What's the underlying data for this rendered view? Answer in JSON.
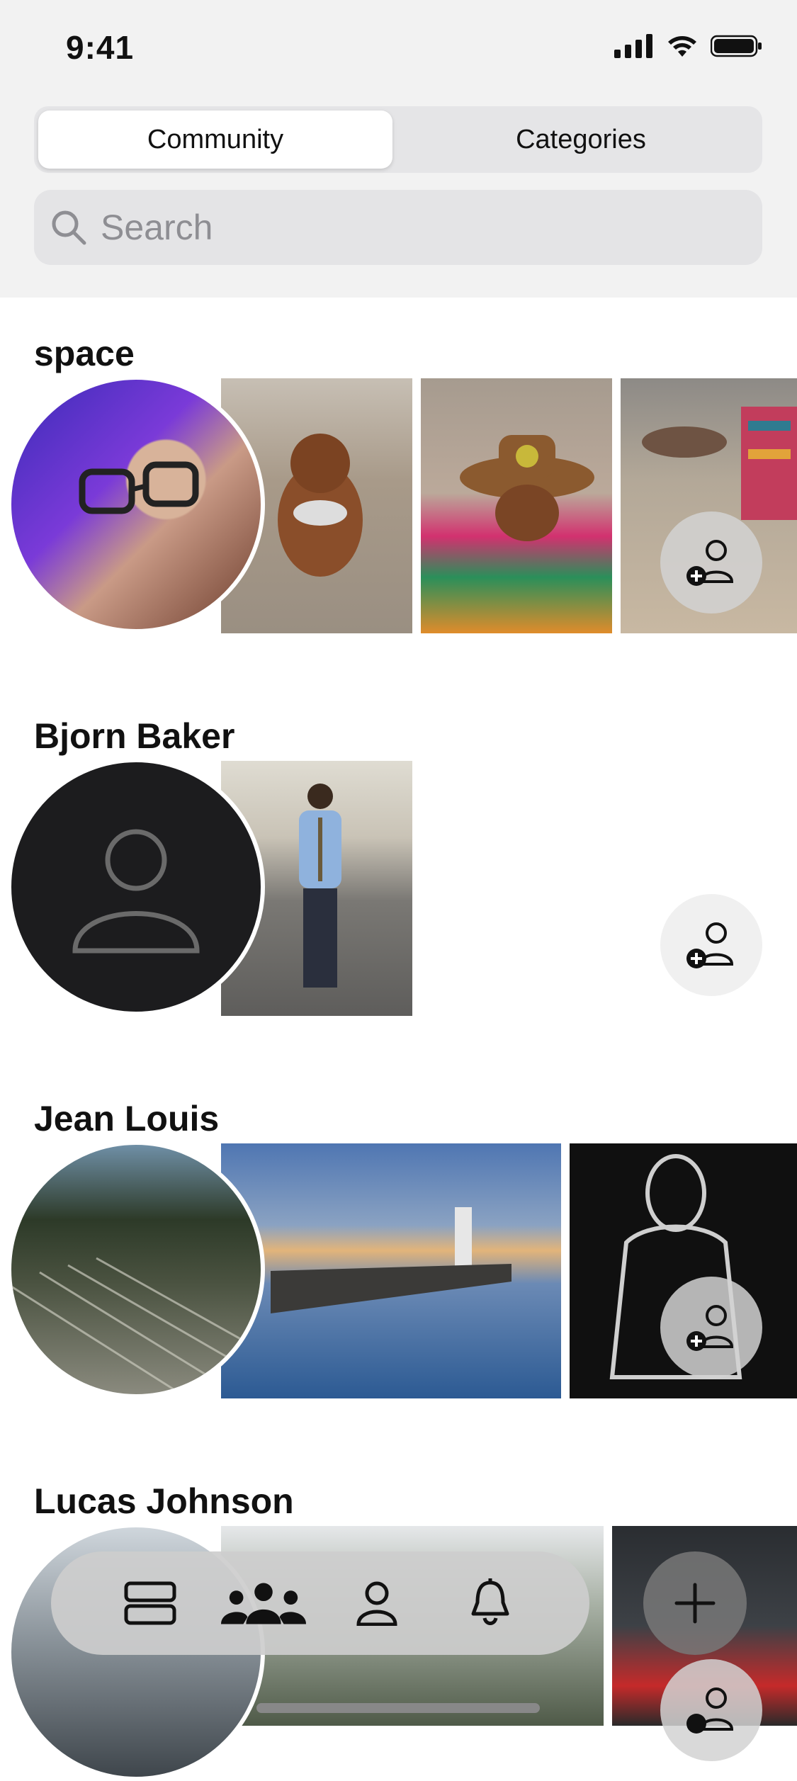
{
  "status": {
    "time": "9:41"
  },
  "segments": {
    "active": "Community",
    "inactive": "Categories"
  },
  "search": {
    "placeholder": "Search"
  },
  "sections": [
    {
      "name": "space"
    },
    {
      "name": "Bjorn Baker"
    },
    {
      "name": "Jean Louis"
    },
    {
      "name": "Lucas Johnson"
    }
  ],
  "tabbar": {
    "items": [
      "feed-icon",
      "community-icon",
      "profile-icon",
      "notifications-icon"
    ],
    "add": "plus-icon"
  }
}
